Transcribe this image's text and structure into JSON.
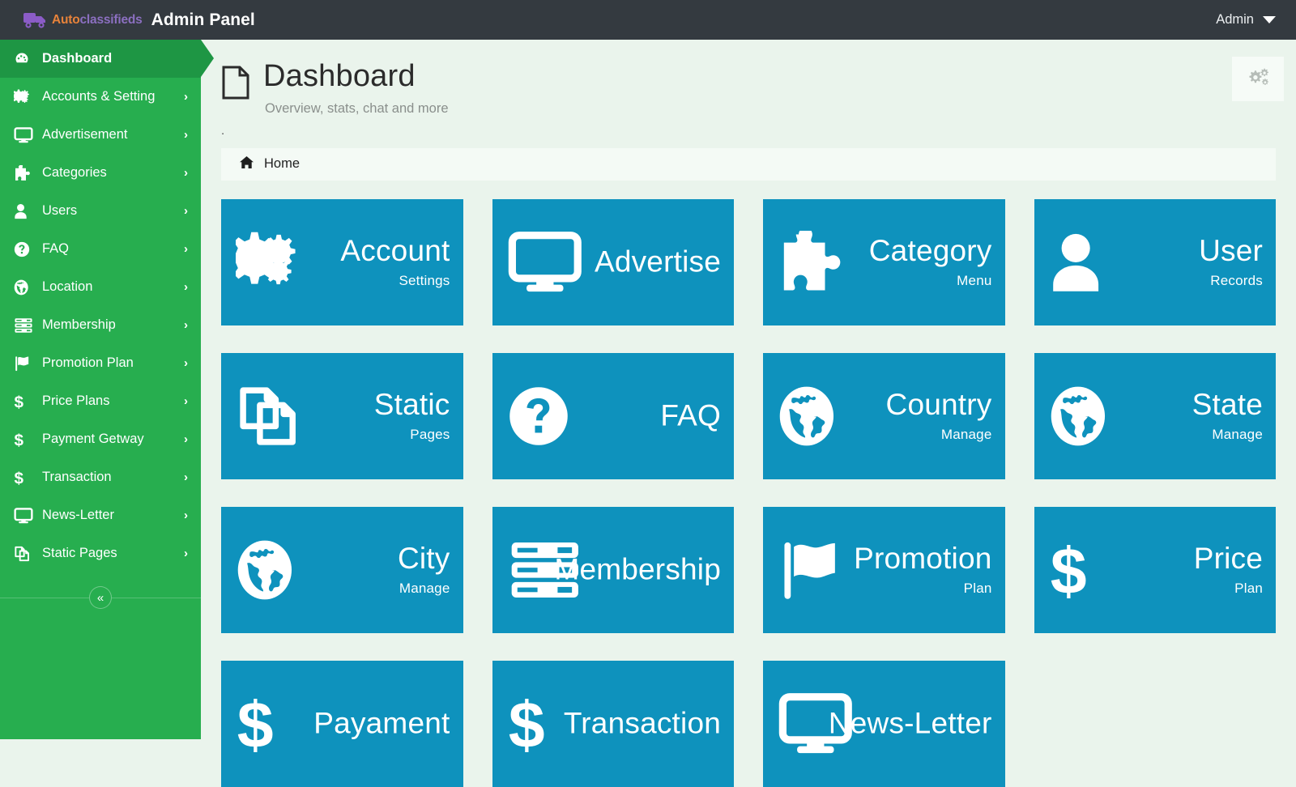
{
  "topbar": {
    "logo_auto": "Auto",
    "logo_classifieds": "classifieds",
    "logo_icon": "truck-icon",
    "title": "Admin Panel",
    "user_label": "Admin",
    "caret_icon": "caret-down-icon"
  },
  "sidebar": {
    "collapse_label": "«",
    "chevron": "›",
    "items": [
      {
        "label": "Dashboard",
        "icon": "dashboard-icon",
        "active": true,
        "has_chevron": false
      },
      {
        "label": "Accounts & Setting",
        "icon": "cogs-icon",
        "active": false,
        "has_chevron": true
      },
      {
        "label": "Advertisement",
        "icon": "desktop-icon",
        "active": false,
        "has_chevron": true
      },
      {
        "label": "Categories",
        "icon": "puzzle-piece-icon",
        "active": false,
        "has_chevron": true
      },
      {
        "label": "Users",
        "icon": "user-icon",
        "active": false,
        "has_chevron": true
      },
      {
        "label": "FAQ",
        "icon": "question-circle-icon",
        "active": false,
        "has_chevron": true
      },
      {
        "label": "Location",
        "icon": "globe-icon",
        "active": false,
        "has_chevron": true
      },
      {
        "label": "Membership",
        "icon": "server-icon",
        "active": false,
        "has_chevron": true
      },
      {
        "label": "Promotion Plan",
        "icon": "flag-icon",
        "active": false,
        "has_chevron": true
      },
      {
        "label": "Price Plans",
        "icon": "dollar-icon",
        "active": false,
        "has_chevron": true
      },
      {
        "label": "Payment Getway",
        "icon": "dollar-icon",
        "active": false,
        "has_chevron": true
      },
      {
        "label": "Transaction",
        "icon": "dollar-icon",
        "active": false,
        "has_chevron": true
      },
      {
        "label": "News-Letter",
        "icon": "desktop-icon",
        "active": false,
        "has_chevron": true
      },
      {
        "label": "Static Pages",
        "icon": "copy-icon",
        "active": false,
        "has_chevron": true
      }
    ]
  },
  "page": {
    "title": "Dashboard",
    "subtitle": "Overview, stats, chat and more",
    "title_icon": "file-icon",
    "dot": ".",
    "settings_icon": "cogs-icon"
  },
  "breadcrumb": {
    "home_icon": "home-icon",
    "home_label": "Home"
  },
  "tiles": [
    {
      "title": "Account",
      "sub": "Settings",
      "icon": "cogs-icon"
    },
    {
      "title": "Advertise",
      "sub": "",
      "icon": "desktop-icon"
    },
    {
      "title": "Category",
      "sub": "Menu",
      "icon": "puzzle-piece-icon"
    },
    {
      "title": "User",
      "sub": "Records",
      "icon": "user-icon"
    },
    {
      "title": "Static",
      "sub": "Pages",
      "icon": "copy-icon"
    },
    {
      "title": "FAQ",
      "sub": "",
      "icon": "question-circle-icon"
    },
    {
      "title": "Country",
      "sub": "Manage",
      "icon": "globe-icon"
    },
    {
      "title": "State",
      "sub": "Manage",
      "icon": "globe-icon"
    },
    {
      "title": "City",
      "sub": "Manage",
      "icon": "globe-icon"
    },
    {
      "title": "Membership",
      "sub": "",
      "icon": "server-icon"
    },
    {
      "title": "Promotion",
      "sub": "Plan",
      "icon": "flag-icon"
    },
    {
      "title": "Price",
      "sub": "Plan",
      "icon": "dollar-icon"
    },
    {
      "title": "Payament",
      "sub": "",
      "icon": "dollar-icon"
    },
    {
      "title": "Transaction",
      "sub": "",
      "icon": "dollar-icon"
    },
    {
      "title": "News-Letter",
      "sub": "",
      "icon": "desktop-icon"
    }
  ],
  "colors": {
    "topbar": "#343a40",
    "sidebar": "#27ae4f",
    "sidebar_active": "#1e9644",
    "tile": "#0e92bd",
    "content_bg": "#eaf4ec",
    "panel_bg": "#f4faf5"
  }
}
